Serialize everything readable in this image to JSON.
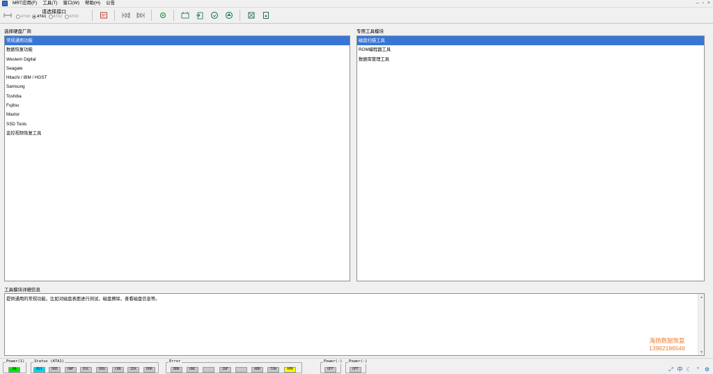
{
  "menubar": {
    "app_title": "MRT应用(F)",
    "items": [
      "工具(T)",
      "窗口(W)",
      "帮助(H)",
      "公告"
    ]
  },
  "toolbar": {
    "port_select_label": "请选择接口",
    "ports": [
      {
        "label": "ATA0",
        "selected": false,
        "enabled": false
      },
      {
        "label": "ATA1",
        "selected": true,
        "enabled": true
      },
      {
        "label": "ATA2",
        "selected": false,
        "enabled": false
      },
      {
        "label": "ATA3",
        "selected": false,
        "enabled": false
      }
    ],
    "buttons": [
      "connect-icon",
      "card-icon",
      "prev-icon",
      "next-icon",
      "settings-icon",
      "rst-icon",
      "export-icon",
      "refresh-icon",
      "up-icon",
      "chip-icon",
      "note-icon"
    ]
  },
  "vendor_panel": {
    "title": "选择硬盘厂商",
    "items": [
      "常规通用功能",
      "数据恢复功能",
      "Western Digital",
      "Seagate",
      "Hitachi / IBM / HGST",
      "Samsung",
      "Toshiba",
      "Fujitsu",
      "Maxtor",
      "SSD Tools",
      "监控视频恢复工具"
    ],
    "selected_index": 0
  },
  "tool_panel": {
    "title": "专用工具模块",
    "items": [
      "磁盘扫描工具",
      "ROM编程器工具",
      "数据库管理工具"
    ],
    "selected_index": 0
  },
  "detail_panel": {
    "title": "工具模块详细信息",
    "text": "提供通用的常规功能，比如对磁盘表面进行测试，磁盘擦除，查看磁盘信息等。"
  },
  "watermark": {
    "line1": "海扬数据恢复",
    "line2": "13962186546",
    "color": "#ee7b2e"
  },
  "statusbar": {
    "power1": {
      "title": "Power(1)",
      "boxes": [
        "ON"
      ]
    },
    "status": {
      "title": "Status (ATA1)",
      "boxes": [
        "BSY",
        "DRD",
        "DWF",
        "DSC",
        "DRQ",
        "CRR",
        "IDX",
        "ERR"
      ]
    },
    "error": {
      "title": "Error",
      "boxes": [
        "BBK",
        "UNC",
        "",
        "INF",
        "",
        "ABR",
        "TON",
        "AMN"
      ]
    },
    "power_a": {
      "title": "Power(-)",
      "boxes": [
        "OFF"
      ]
    },
    "power_b": {
      "title": "Power(-)",
      "boxes": [
        "OFF"
      ]
    },
    "colors": {
      "on": "#00e800",
      "active": "#00d4f0",
      "warn": "#ffff00"
    }
  },
  "tray": {
    "ime": "中"
  }
}
